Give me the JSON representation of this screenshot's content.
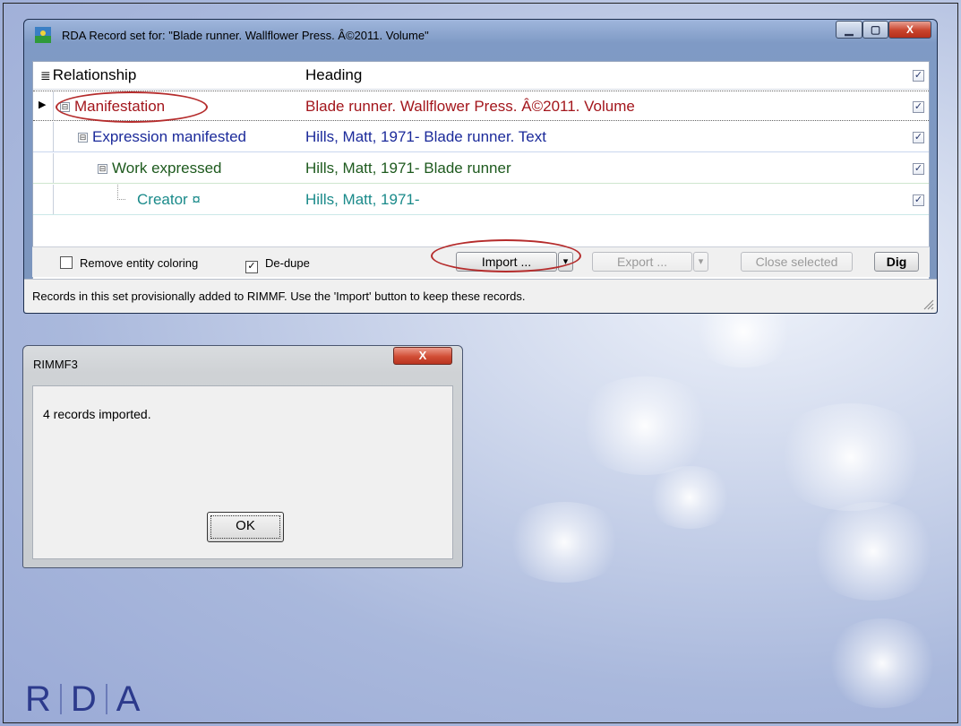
{
  "main_window": {
    "title": "RDA Record set for: \"Blade runner. Wallflower Press. Â©2011. Volume\"",
    "title_buttons": {
      "minimize": "▁",
      "maximize": "▢",
      "close": "X"
    },
    "columns": {
      "relationship": "Relationship",
      "heading": "Heading",
      "header_checkbox": "✓"
    },
    "rows": [
      {
        "relationship": "Manifestation",
        "heading": "Blade runner. Wallflower Press. Â©2011. Volume",
        "checked": "✓",
        "color": "#a3161c",
        "toggle": "⊟"
      },
      {
        "relationship": "Expression manifested",
        "heading": "Hills, Matt, 1971- Blade runner. Text",
        "checked": "✓",
        "color": "#1b2a9a",
        "toggle": "⊟"
      },
      {
        "relationship": "Work expressed",
        "heading": "Hills, Matt, 1971- Blade runner",
        "checked": "✓",
        "color": "#1e5a1e",
        "toggle": "⊟"
      },
      {
        "relationship": "Creator ¤",
        "heading": "Hills, Matt, 1971-",
        "checked": "✓",
        "color": "#1a8a8a",
        "toggle": ""
      }
    ],
    "row_pointer": "▶",
    "options": {
      "remove_coloring": "Remove entity coloring",
      "remove_coloring_checked": "",
      "dedupe": "De-dupe",
      "dedupe_checked": "✓"
    },
    "buttons": {
      "import": "Import ...",
      "import_arrow": "▾",
      "export": "Export ...",
      "export_arrow": "▾",
      "close_selected": "Close selected",
      "dig": "Dig"
    },
    "status": "Records in this set provisionally added to RIMMF. Use the 'Import' button to keep these records."
  },
  "dialog": {
    "title": "RIMMF3",
    "close": "X",
    "message": "4 records imported.",
    "ok": "OK"
  },
  "logo": {
    "letters": [
      "R",
      "D",
      "A"
    ]
  }
}
